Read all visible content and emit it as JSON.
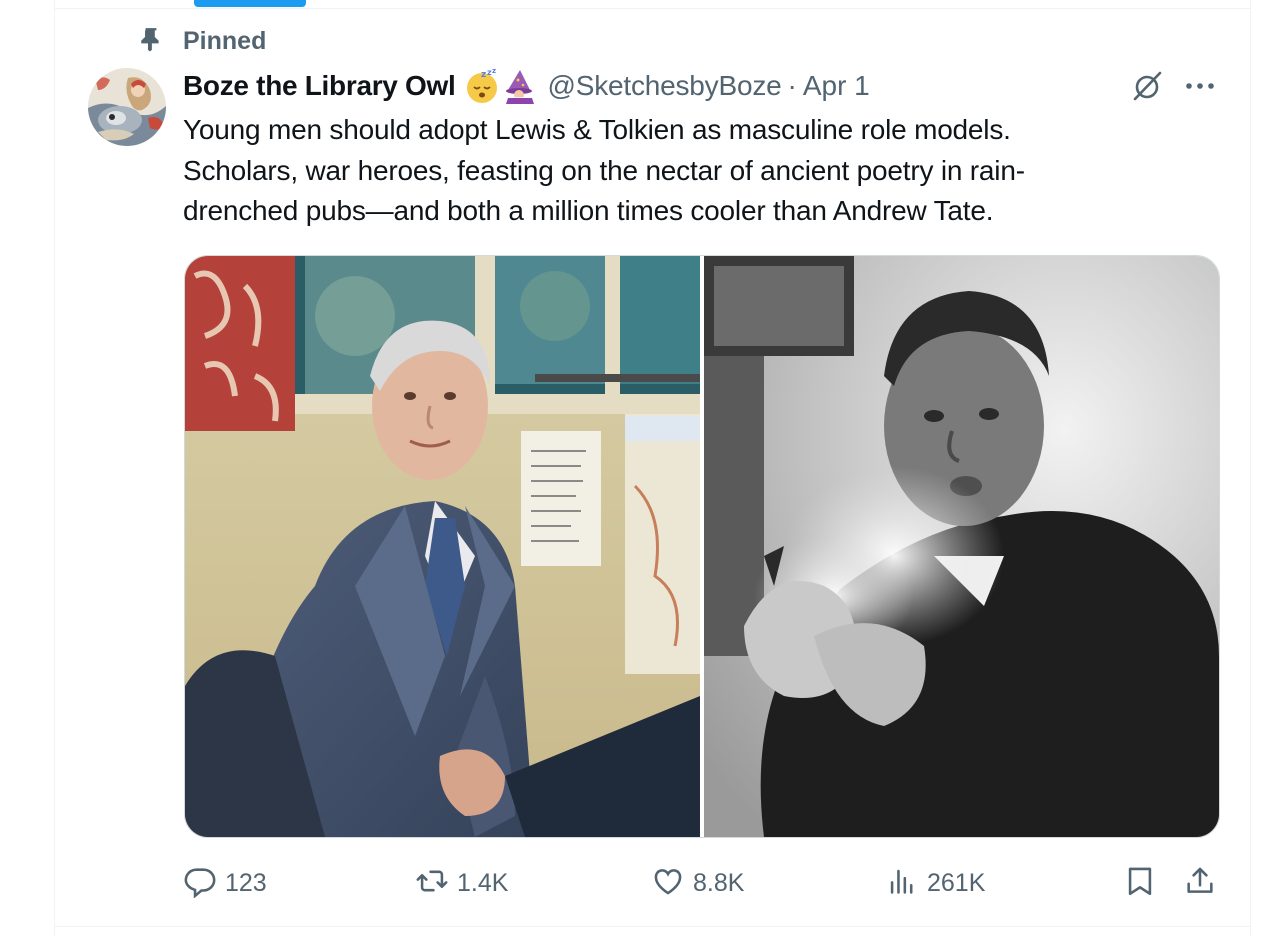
{
  "pinned_label": "Pinned",
  "author": {
    "display_name": "Boze the Library Owl",
    "emojis": [
      "sleeping-face-emoji",
      "mage-emoji"
    ],
    "handle": "@SketchesbyBoze",
    "separator": "·",
    "date": "Apr 1"
  },
  "tweet_text": [
    "Young men should adopt Lewis & Tolkien as masculine role models.",
    "Scholars, war heroes, feasting on the nectar of ancient poetry in rain-",
    "drenched pubs—and both a million times cooler than Andrew Tate."
  ],
  "media": {
    "photos": [
      "tolkien-photo",
      "lewis-photo"
    ]
  },
  "actions": {
    "replies": "123",
    "reposts": "1.4K",
    "likes": "8.8K",
    "views": "261K"
  },
  "colors": {
    "accent": "#1d9bf0",
    "text_primary": "#0f1419",
    "text_secondary": "#536471",
    "border": "#eff3f4"
  },
  "icons": {
    "pin": "pin-icon",
    "grok": "grok-icon",
    "more": "more-icon",
    "reply": "reply-icon",
    "repost": "repost-icon",
    "like": "like-icon",
    "views": "views-icon",
    "bookmark": "bookmark-icon",
    "share": "share-icon"
  }
}
